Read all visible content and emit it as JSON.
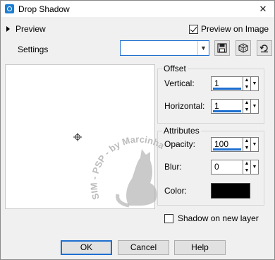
{
  "window": {
    "title": "Drop Shadow",
    "close_glyph": "✕"
  },
  "preview": {
    "toggle_label": "Preview",
    "on_image_label": "Preview on Image",
    "on_image_checked": true
  },
  "settings": {
    "label": "Settings",
    "value": ""
  },
  "offset": {
    "title": "Offset",
    "vertical_label": "Vertical:",
    "vertical_value": "1",
    "horizontal_label": "Horizontal:",
    "horizontal_value": "1"
  },
  "attributes": {
    "title": "Attributes",
    "opacity_label": "Opacity:",
    "opacity_value": "100",
    "blur_label": "Blur:",
    "blur_value": "0",
    "color_label": "Color:",
    "color_value": "#000000"
  },
  "shadow_on_new_layer": {
    "label": "Shadow on new layer",
    "checked": false
  },
  "buttons": {
    "ok": "OK",
    "cancel": "Cancel",
    "help": "Help"
  },
  "watermark": {
    "text": "SIM - PSP - by Marcinha"
  }
}
